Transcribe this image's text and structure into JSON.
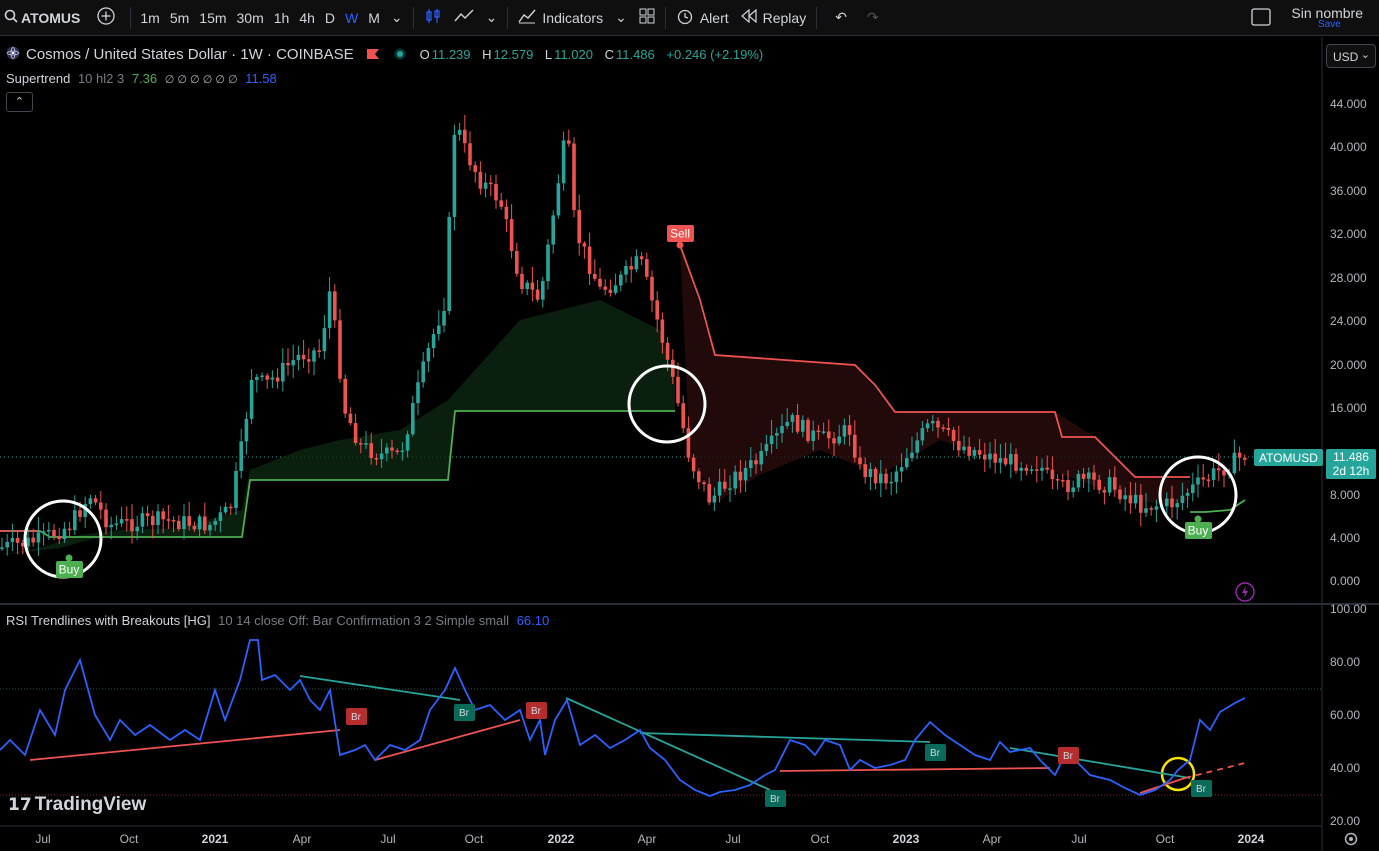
{
  "toolbar": {
    "symbol": "ATOMUS",
    "timeframes": [
      "1m",
      "5m",
      "15m",
      "30m",
      "1h",
      "4h",
      "D",
      "W",
      "M"
    ],
    "active_timeframe": "W",
    "indicators_label": "Indicators",
    "alert_label": "Alert",
    "replay_label": "Replay",
    "layout_name": "Sin nombre",
    "save_label": "Save"
  },
  "legend": {
    "title": "Cosmos / United States Dollar · 1W · COINBASE",
    "o_label": "O",
    "o": "11.239",
    "h_label": "H",
    "h": "12.579",
    "l_label": "L",
    "l": "11.020",
    "c_label": "C",
    "c": "11.486",
    "change": "+0.246 (+2.19%)"
  },
  "supertrend": {
    "label": "Supertrend",
    "params": "10 hl2 3",
    "value_up": "7.36",
    "empty": "∅ ∅ ∅ ∅ ∅ ∅",
    "value_down": "11.58"
  },
  "rsi": {
    "label": "RSI Trendlines with Breakouts [HG]",
    "params": "10 14 close Off: Bar Confirmation 3 2 Simple small",
    "value": "66.10"
  },
  "currency": "USD",
  "price_axis": [
    "44.000",
    "40.000",
    "36.000",
    "32.000",
    "28.000",
    "24.000",
    "20.000",
    "16.000",
    "8.000",
    "4.000",
    "0.000"
  ],
  "rsi_axis": [
    "100.00",
    "80.00",
    "60.00",
    "40.00",
    "20.00"
  ],
  "time_axis": [
    {
      "label": "Jul",
      "bold": false
    },
    {
      "label": "Oct",
      "bold": false
    },
    {
      "label": "2021",
      "bold": true
    },
    {
      "label": "Apr",
      "bold": false
    },
    {
      "label": "Jul",
      "bold": false
    },
    {
      "label": "Oct",
      "bold": false
    },
    {
      "label": "2022",
      "bold": true
    },
    {
      "label": "Apr",
      "bold": false
    },
    {
      "label": "Jul",
      "bold": false
    },
    {
      "label": "Oct",
      "bold": false
    },
    {
      "label": "2023",
      "bold": true
    },
    {
      "label": "Apr",
      "bold": false
    },
    {
      "label": "Jul",
      "bold": false
    },
    {
      "label": "Oct",
      "bold": false
    },
    {
      "label": "2024",
      "bold": true
    }
  ],
  "signals": {
    "buy": "Buy",
    "sell": "Sell",
    "breakout": "Br"
  },
  "last_price": {
    "symbol": "ATOMUSD",
    "price": "11.486",
    "countdown": "2d 12h"
  },
  "brand": "TradingView",
  "colors": {
    "up": "#26a69a",
    "down": "#ef5350",
    "rsi": "#2962ff",
    "accent": "#2962ff"
  }
}
